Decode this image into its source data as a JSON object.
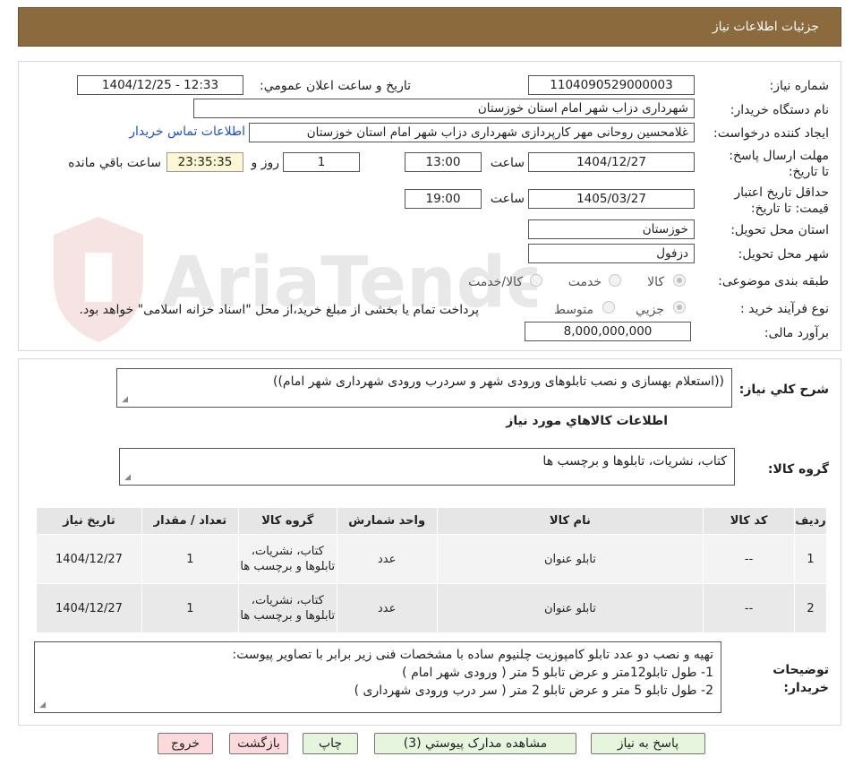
{
  "header": {
    "title": "جزئیات اطلاعات نیاز"
  },
  "form": {
    "need_number_label": "شماره نیاز:",
    "need_number": "1104090529000003",
    "announce_label": "تاریخ و ساعت اعلان عمومي:",
    "announce_value": "1404/12/25 - 12:33",
    "buyer_org_label": "نام دستگاه خریدار:",
    "buyer_org": "شهرداری دزاب شهر امام استان خوزستان",
    "requester_label": "ایجاد کننده درخواست:",
    "requester": "غلامحسین روحانی مهر کارپردازی شهرداری دزاب شهر امام استان خوزستان",
    "contact_link": "اطلاعات تماس خریدار",
    "deadline_label": "مهلت ارسال پاسخ: تا تاریخ:",
    "deadline_date": "1404/12/27",
    "time_label": "ساعت",
    "deadline_time": "13:00",
    "days_value": "1",
    "days_label": "روز و",
    "remaining_time": "23:35:35",
    "remaining_label": "ساعت باقي مانده",
    "price_validity_label": "حداقل تاریخ اعتبار قیمت: تا تاریخ:",
    "price_validity_date": "1405/03/27",
    "price_validity_time": "19:00",
    "province_label": "استان محل تحویل:",
    "province": "خوزستان",
    "city_label": "شهر محل تحویل:",
    "city": "دزفول",
    "category_label": "طبقه بندی موضوعی:",
    "category_options": [
      "کالا",
      "خدمت",
      "کالا/خدمت"
    ],
    "process_label": "نوع فرآیند خرید :",
    "process_options": [
      "جزیي",
      "متوسط"
    ],
    "payment_note": "پرداخت تمام یا بخشی از مبلغ خرید،از محل \"اسناد خزانه اسلامی\" خواهد بود.",
    "budget_label": "برآورد مالی:",
    "budget": "8,000,000,000"
  },
  "details": {
    "general_desc_label": "شرح کلي نیاز:",
    "general_desc": "((استعلام بهسازی و نصب تابلوهای ورودی شهر و سردرب ورودی شهرداری شهر امام))",
    "goods_info_title": "اطلاعات کالاهاي مورد نیاز",
    "goods_group_label": "گروه کالا:",
    "goods_group": "کتاب، نشریات، تابلوها و برچسب ها",
    "table": {
      "headers": [
        "ردیف",
        "کد کالا",
        "نام کالا",
        "واحد شمارش",
        "گروه کالا",
        "تعداد / مقدار",
        "تاریخ نیاز"
      ],
      "rows": [
        [
          "1",
          "--",
          "تابلو عنوان",
          "عدد",
          "کتاب، نشریات، تابلوها و برچسب ها",
          "1",
          "1404/12/27"
        ],
        [
          "2",
          "--",
          "تابلو عنوان",
          "عدد",
          "کتاب، نشریات، تابلوها و برچسب ها",
          "1",
          "1404/12/27"
        ]
      ]
    },
    "buyer_notes_label": "توضیحات خریدار:",
    "buyer_notes": [
      "تهیه و نصب دو عدد تابلو کامپوزیت چلنیوم ساده با مشخصات فنی زیر برابر با تصاویر پیوست:",
      "1- طول تابلو12متر و عرض تابلو 5 متر ( ورودی شهر امام )",
      "2- طول تابلو 5 متر و عرض تابلو 2 متر ( سر درب ورودی شهرداری )"
    ]
  },
  "buttons": {
    "reply": "پاسخ به نیاز",
    "attachments": "مشاهده مدارک پیوستي (3)",
    "print": "چاپ",
    "back": "بازگشت",
    "exit": "خروج"
  },
  "watermark": {
    "text": "AriaTender.neT"
  }
}
